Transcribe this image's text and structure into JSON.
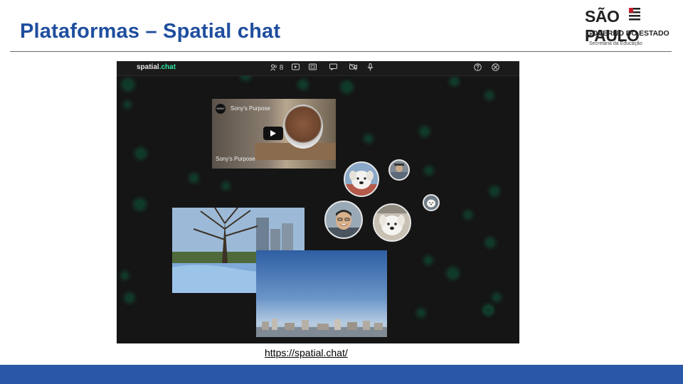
{
  "slide": {
    "title": "Plataformas – Spatial chat",
    "link_text": "https://spatial.chat/"
  },
  "logo": {
    "line1": "SÃO PAULO",
    "line2": "GOVERNO DO ESTADO",
    "line3": "Secretaria da Educação"
  },
  "app": {
    "brand_main": "spatial",
    "brand_suffix": ".chat",
    "toolbar": {
      "participants_count": "8",
      "icons": [
        "people-icon",
        "youtube-icon",
        "screen-share-icon",
        "camera-icon",
        "chat-icon",
        "camera-off-icon",
        "mic-icon",
        "help-icon",
        "settings-icon"
      ]
    },
    "video": {
      "channel": "SONY",
      "title": "Sony's Purpose",
      "caption": "Sony's Purpose"
    }
  },
  "colors": {
    "title": "#1f4e9e",
    "footer": "#2b58a6",
    "app_bg": "#151515",
    "accent": "#2ee6a0"
  }
}
